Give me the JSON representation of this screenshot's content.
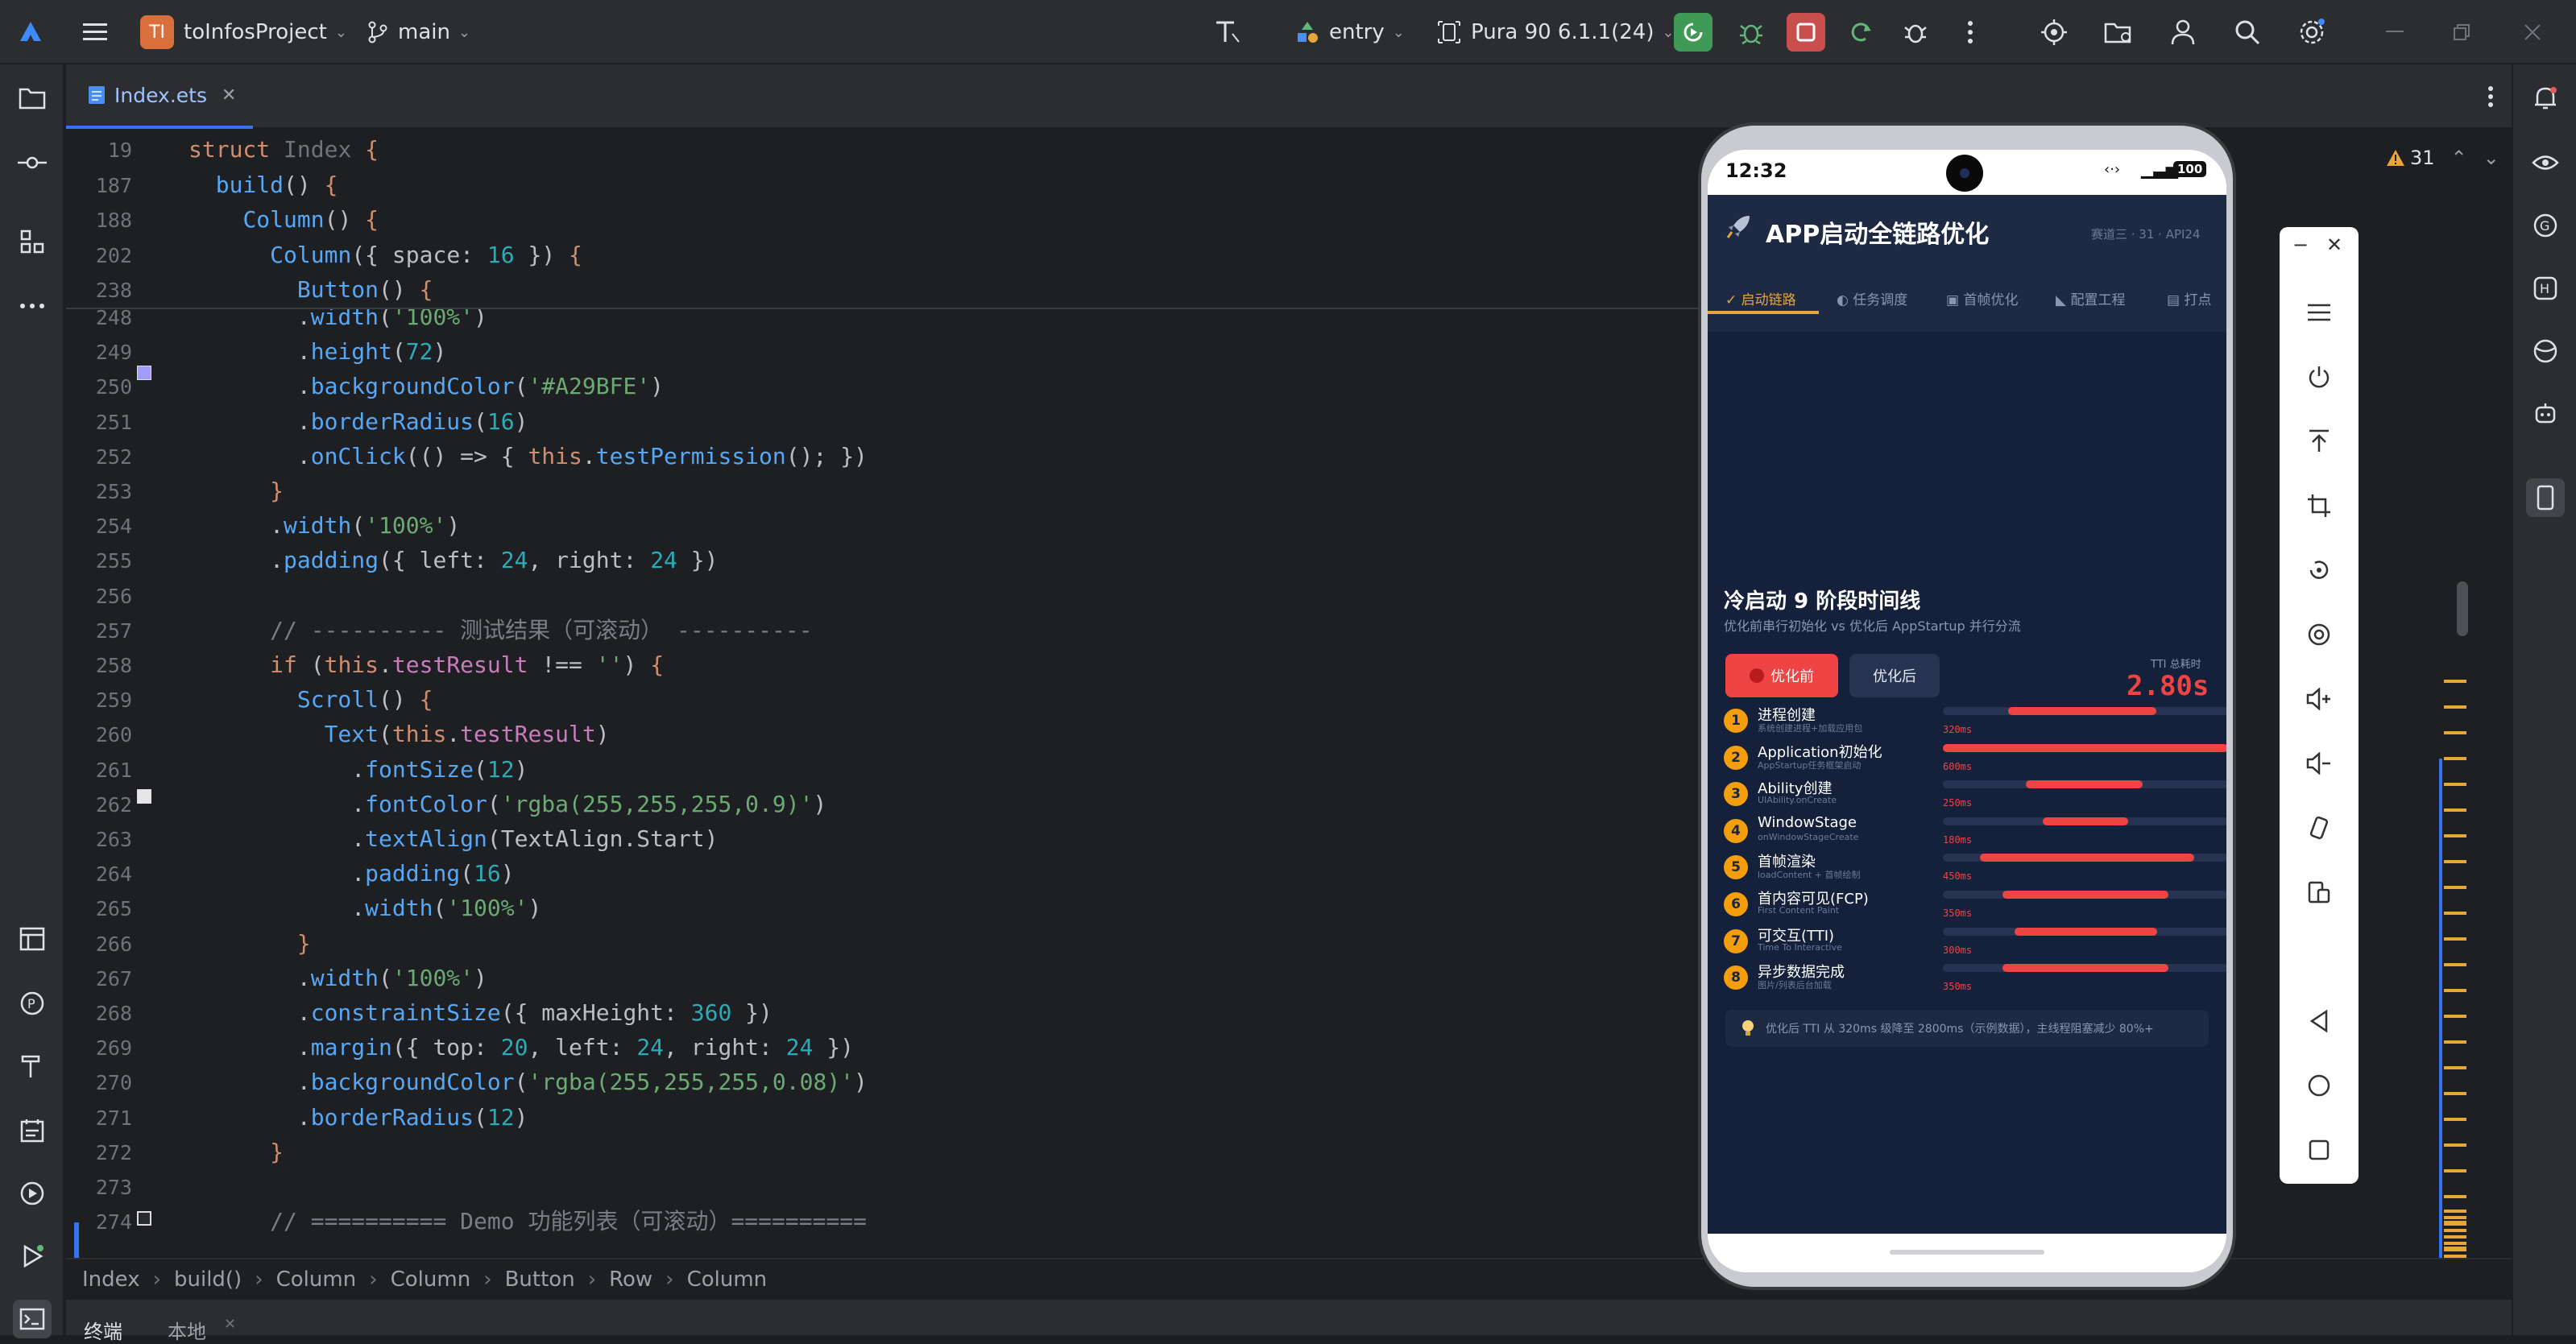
{
  "topbar": {
    "project_initials": "TI",
    "project_name": "toInfosProject",
    "branch": "main",
    "module": "entry",
    "device": "Pura 90 6.1.1(24)"
  },
  "tab": {
    "file_name": "Index.ets"
  },
  "editor": {
    "warnings_count": "31",
    "sticky": [
      {
        "ln": "19",
        "html": "<span class=\"kw\">struct</span> <span style=\"color:#6f737a\">Index</span> <span class=\"kw\">{</span>"
      },
      {
        "ln": "187",
        "html": "  <span class=\"fn\">build</span>() <span class=\"kw\">{</span>"
      },
      {
        "ln": "188",
        "html": "    <span class=\"fn\">Column</span>() <span class=\"kw\">{</span>"
      },
      {
        "ln": "202",
        "html": "      <span class=\"fn\">Column</span>({ space: <span class=\"num\">16</span> }) <span class=\"kw\">{</span>"
      },
      {
        "ln": "238",
        "html": "        <span class=\"fn\">Button</span>() <span class=\"kw\">{</span>"
      }
    ],
    "lines": [
      {
        "ln": "248",
        "html": "        .<span class=\"fn\">width</span>(<span class=\"str\">'100%'</span>)"
      },
      {
        "ln": "249",
        "html": "        .<span class=\"fn\">height</span>(<span class=\"num\">72</span>)"
      },
      {
        "ln": "250",
        "html": "        .<span class=\"fn\">backgroundColor</span>(<span class=\"str\">'#A29BFE'</span>)"
      },
      {
        "ln": "251",
        "html": "        .<span class=\"fn\">borderRadius</span>(<span class=\"num\">16</span>)"
      },
      {
        "ln": "252",
        "html": "        .<span class=\"fn\">onClick</span>(() => { <span class=\"kw\">this</span>.<span class=\"fn\">testPermission</span>(); })"
      },
      {
        "ln": "253",
        "html": "      <span class=\"kw\">}</span>"
      },
      {
        "ln": "254",
        "html": "      .<span class=\"fn\">width</span>(<span class=\"str\">'100%'</span>)"
      },
      {
        "ln": "255",
        "html": "      .<span class=\"fn\">padding</span>({ left: <span class=\"num\">24</span>, right: <span class=\"num\">24</span> })"
      },
      {
        "ln": "256",
        "html": ""
      },
      {
        "ln": "257",
        "html": "      <span class=\"cm\">// ---------- 测试结果（可滚动） ----------</span>"
      },
      {
        "ln": "258",
        "html": "      <span class=\"kw\">if</span> (<span class=\"kw\">this</span>.<span class=\"pr\">testResult</span> !== <span class=\"str\">''</span>) <span class=\"kw\">{</span>"
      },
      {
        "ln": "259",
        "html": "        <span class=\"fn\">Scroll</span>() <span class=\"kw\">{</span>"
      },
      {
        "ln": "260",
        "html": "          <span class=\"fn\">Text</span>(<span class=\"kw\">this</span>.<span class=\"pr\">testResult</span>)"
      },
      {
        "ln": "261",
        "html": "            .<span class=\"fn\">fontSize</span>(<span class=\"num\">12</span>)"
      },
      {
        "ln": "262",
        "html": "            .<span class=\"fn\">fontColor</span>(<span class=\"str\">'rgba(255,255,255,0.9)'</span>)"
      },
      {
        "ln": "263",
        "html": "            .<span class=\"fn\">textAlign</span>(TextAlign.Start)"
      },
      {
        "ln": "264",
        "html": "            .<span class=\"fn\">padding</span>(<span class=\"num\">16</span>)"
      },
      {
        "ln": "265",
        "html": "            .<span class=\"fn\">width</span>(<span class=\"str\">'100%'</span>)"
      },
      {
        "ln": "266",
        "html": "        <span class=\"kw\">}</span>"
      },
      {
        "ln": "267",
        "html": "        .<span class=\"fn\">width</span>(<span class=\"str\">'100%'</span>)"
      },
      {
        "ln": "268",
        "html": "        .<span class=\"fn\">constraintSize</span>({ maxHeight: <span class=\"num\">360</span> })"
      },
      {
        "ln": "269",
        "html": "        .<span class=\"fn\">margin</span>({ top: <span class=\"num\">20</span>, left: <span class=\"num\">24</span>, right: <span class=\"num\">24</span> })"
      },
      {
        "ln": "270",
        "html": "        .<span class=\"fn\">backgroundColor</span>(<span class=\"str\">'rgba(255,255,255,0.08)'</span>)"
      },
      {
        "ln": "271",
        "html": "        .<span class=\"fn\">borderRadius</span>(<span class=\"num\">12</span>)"
      },
      {
        "ln": "272",
        "html": "      <span class=\"kw\">}</span>"
      },
      {
        "ln": "273",
        "html": ""
      },
      {
        "ln": "274",
        "html": "      <span class=\"cm\">// ========== Demo 功能列表（可滚动）==========</span>"
      }
    ]
  },
  "breadcrumbs": [
    "Index",
    "build()",
    "Column",
    "Column",
    "Button",
    "Row",
    "Column"
  ],
  "bottom_tabs": [
    "终端",
    "本地"
  ],
  "phone": {
    "time": "12:32",
    "battery": "100",
    "app_title": "APP启动全链路优化",
    "app_meta": "赛道三 · 31 · API24",
    "tabs": [
      "启动链路",
      "任务调度",
      "首帧优化",
      "配置工程",
      "打点"
    ],
    "section_title": "冷启动 9 阶段时间线",
    "section_subtitle": "优化前串行初始化 vs 优化后 AppStartup 并行分流",
    "btn_before": "优化前",
    "btn_after": "优化后",
    "tti_label": "TTI 总耗时",
    "tti_value": "2.80s",
    "stages": [
      {
        "n": "1",
        "name": "进程创建",
        "sub": "系统创建进程+加载应用包",
        "ms": "320ms"
      },
      {
        "n": "2",
        "name": "Application初始化",
        "sub": "AppStartup任务框架启动",
        "ms": "600ms"
      },
      {
        "n": "3",
        "name": "Ability创建",
        "sub": "UIAbility.onCreate",
        "ms": "250ms"
      },
      {
        "n": "4",
        "name": "WindowStage",
        "sub": "onWindowStageCreate",
        "ms": "180ms"
      },
      {
        "n": "5",
        "name": "首帧渲染",
        "sub": "loadContent + 首帧绘制",
        "ms": "450ms"
      },
      {
        "n": "6",
        "name": "首内容可见(FCP)",
        "sub": "First Content Paint",
        "ms": "350ms"
      },
      {
        "n": "7",
        "name": "可交互(TTI)",
        "sub": "Time To Interactive",
        "ms": "300ms"
      },
      {
        "n": "8",
        "name": "异步数据完成",
        "sub": "图片/列表后台加载",
        "ms": "350ms"
      }
    ],
    "tip": "优化后 TTI 从 320ms 级降至 2800ms（示例数据），主线程阻塞减少 80%+"
  },
  "colors": {
    "accent": "#ef4444",
    "stage_circle": "#f59e0b",
    "run_green": "#3e9a55",
    "stop_red": "#c94f4f"
  }
}
